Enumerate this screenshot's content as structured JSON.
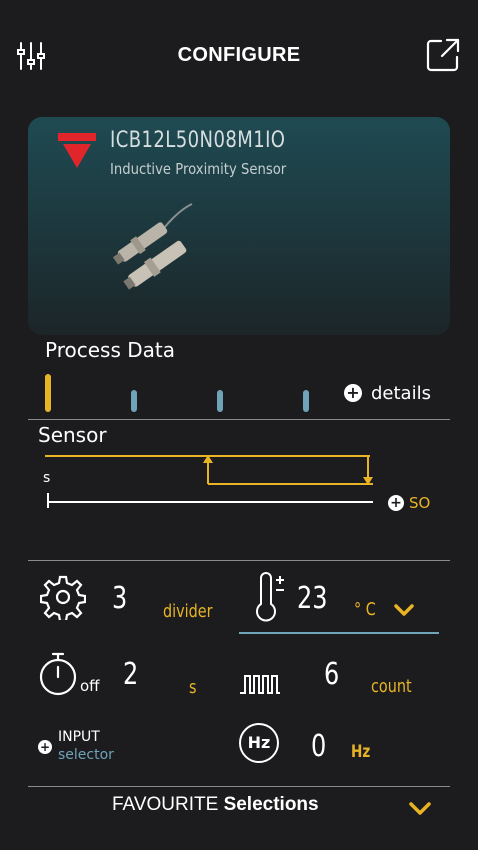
{
  "header": {
    "title": "CONFIGURE",
    "left_icon": "sliders-icon",
    "right_icon": "external-link-icon"
  },
  "device": {
    "model": "ICB12L50N08M1IO",
    "description": "Inductive Proximity Sensor",
    "brand_logo": "carlo-gavazzi-logo"
  },
  "process_data": {
    "heading": "Process Data",
    "details_label": "details",
    "indicator_active": 0,
    "indicator_count": 4
  },
  "sensor": {
    "heading": "Sensor",
    "s_label": "s",
    "so_label": "SO"
  },
  "settings": {
    "divider_value": "3",
    "divider_label": "divider",
    "temp_value": "23",
    "temp_unit": "° C",
    "timer_value": "2",
    "timer_off_label": "off",
    "timer_unit": "s",
    "count_value": "6",
    "count_label": "count",
    "input_label": "INPUT",
    "input_sub": "selector",
    "hz_icon_label": "Hz",
    "freq_value": "0",
    "freq_unit": "Hz"
  },
  "footer": {
    "label_prefix": "FAVOURITE",
    "label_bold": "Selections"
  },
  "colors": {
    "accent": "#e8b425",
    "blue": "#6fa3b8",
    "background": "#1c1c1e"
  }
}
